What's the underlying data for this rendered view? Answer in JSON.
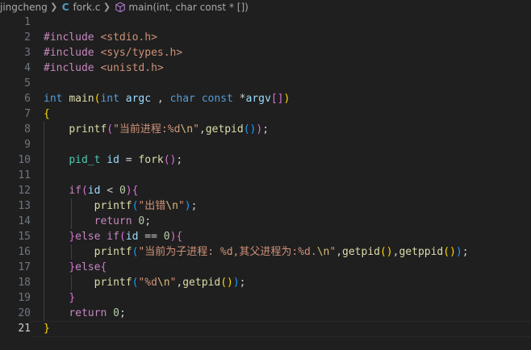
{
  "breadcrumb": {
    "folder": "jingcheng",
    "file": "fork.c",
    "file_icon_letter": "C",
    "symbol": "main(int, char const * [])",
    "symbol_icon": "cube-icon",
    "separator_icon": "chevron-right-icon"
  },
  "editor": {
    "language": "c",
    "active_line": 21,
    "theme_colors": {
      "background": "#1f1f1f",
      "keyword": "#c586c0",
      "type": "#569cd6",
      "string": "#ce9178",
      "function": "#dcdcaa",
      "variable": "#9cdcfe",
      "number": "#b5cea8"
    },
    "lines": [
      {
        "num": "1",
        "tokens": []
      },
      {
        "num": "2",
        "tokens": [
          {
            "t": "#include",
            "c": "t-kw"
          },
          {
            "t": " ",
            "c": "t-pl"
          },
          {
            "t": "<stdio.h>",
            "c": "t-str"
          }
        ]
      },
      {
        "num": "3",
        "tokens": [
          {
            "t": "#include",
            "c": "t-kw"
          },
          {
            "t": " ",
            "c": "t-pl"
          },
          {
            "t": "<sys/types.h>",
            "c": "t-str"
          }
        ]
      },
      {
        "num": "4",
        "tokens": [
          {
            "t": "#include",
            "c": "t-kw"
          },
          {
            "t": " ",
            "c": "t-pl"
          },
          {
            "t": "<unistd.h>",
            "c": "t-str"
          }
        ]
      },
      {
        "num": "5",
        "tokens": []
      },
      {
        "num": "6",
        "tokens": [
          {
            "t": "int",
            "c": "t-ty"
          },
          {
            "t": " ",
            "c": "t-pl"
          },
          {
            "t": "main",
            "c": "t-fn"
          },
          {
            "t": "(",
            "c": "t-b1"
          },
          {
            "t": "int",
            "c": "t-ty"
          },
          {
            "t": " ",
            "c": "t-pl"
          },
          {
            "t": "argc",
            "c": "t-var"
          },
          {
            "t": " , ",
            "c": "t-pl"
          },
          {
            "t": "char",
            "c": "t-ty"
          },
          {
            "t": " ",
            "c": "t-pl"
          },
          {
            "t": "const",
            "c": "t-ty"
          },
          {
            "t": " *",
            "c": "t-pl"
          },
          {
            "t": "argv",
            "c": "t-var"
          },
          {
            "t": "[]",
            "c": "t-b2"
          },
          {
            "t": ")",
            "c": "t-b1"
          }
        ]
      },
      {
        "num": "7",
        "tokens": [
          {
            "t": "{",
            "c": "t-b1"
          }
        ]
      },
      {
        "num": "8",
        "tokens": [
          {
            "t": "    ",
            "c": "t-pl"
          },
          {
            "t": "printf",
            "c": "t-fn"
          },
          {
            "t": "(",
            "c": "t-b2"
          },
          {
            "t": "\"当前进程:%d",
            "c": "t-str"
          },
          {
            "t": "\\n",
            "c": "t-esc"
          },
          {
            "t": "\"",
            "c": "t-str"
          },
          {
            "t": ",",
            "c": "t-pl"
          },
          {
            "t": "getpid",
            "c": "t-fn"
          },
          {
            "t": "()",
            "c": "t-b3"
          },
          {
            "t": ")",
            "c": "t-b2"
          },
          {
            "t": ";",
            "c": "t-pl"
          }
        ]
      },
      {
        "num": "9",
        "tokens": []
      },
      {
        "num": "10",
        "tokens": [
          {
            "t": "    ",
            "c": "t-pl"
          },
          {
            "t": "pid_t",
            "c": "t-tp"
          },
          {
            "t": " ",
            "c": "t-pl"
          },
          {
            "t": "id",
            "c": "t-var"
          },
          {
            "t": " = ",
            "c": "t-pl"
          },
          {
            "t": "fork",
            "c": "t-fn"
          },
          {
            "t": "()",
            "c": "t-b2"
          },
          {
            "t": ";",
            "c": "t-pl"
          }
        ]
      },
      {
        "num": "11",
        "tokens": []
      },
      {
        "num": "12",
        "tokens": [
          {
            "t": "    ",
            "c": "t-pl"
          },
          {
            "t": "if",
            "c": "t-kw"
          },
          {
            "t": "(",
            "c": "t-b2"
          },
          {
            "t": "id",
            "c": "t-var"
          },
          {
            "t": " < ",
            "c": "t-pl"
          },
          {
            "t": "0",
            "c": "t-num"
          },
          {
            "t": ")",
            "c": "t-b2"
          },
          {
            "t": "{",
            "c": "t-b2"
          }
        ]
      },
      {
        "num": "13",
        "tokens": [
          {
            "t": "        ",
            "c": "t-pl"
          },
          {
            "t": "printf",
            "c": "t-fn"
          },
          {
            "t": "(",
            "c": "t-b3"
          },
          {
            "t": "\"出错",
            "c": "t-str"
          },
          {
            "t": "\\n",
            "c": "t-esc"
          },
          {
            "t": "\"",
            "c": "t-str"
          },
          {
            "t": ")",
            "c": "t-b3"
          },
          {
            "t": ";",
            "c": "t-pl"
          }
        ]
      },
      {
        "num": "14",
        "tokens": [
          {
            "t": "        ",
            "c": "t-pl"
          },
          {
            "t": "return",
            "c": "t-kw"
          },
          {
            "t": " ",
            "c": "t-pl"
          },
          {
            "t": "0",
            "c": "t-num"
          },
          {
            "t": ";",
            "c": "t-pl"
          }
        ]
      },
      {
        "num": "15",
        "tokens": [
          {
            "t": "    ",
            "c": "t-pl"
          },
          {
            "t": "}",
            "c": "t-b2"
          },
          {
            "t": "else",
            "c": "t-kw"
          },
          {
            "t": " ",
            "c": "t-pl"
          },
          {
            "t": "if",
            "c": "t-kw"
          },
          {
            "t": "(",
            "c": "t-b2"
          },
          {
            "t": "id",
            "c": "t-var"
          },
          {
            "t": " == ",
            "c": "t-pl"
          },
          {
            "t": "0",
            "c": "t-num"
          },
          {
            "t": ")",
            "c": "t-b2"
          },
          {
            "t": "{",
            "c": "t-b2"
          }
        ]
      },
      {
        "num": "16",
        "tokens": [
          {
            "t": "        ",
            "c": "t-pl"
          },
          {
            "t": "printf",
            "c": "t-fn"
          },
          {
            "t": "(",
            "c": "t-b3"
          },
          {
            "t": "\"当前为子进程: %d,其父进程为:%d.",
            "c": "t-str"
          },
          {
            "t": "\\n",
            "c": "t-esc"
          },
          {
            "t": "\"",
            "c": "t-str"
          },
          {
            "t": ",",
            "c": "t-pl"
          },
          {
            "t": "getpid",
            "c": "t-fn"
          },
          {
            "t": "()",
            "c": "t-b1"
          },
          {
            "t": ",",
            "c": "t-pl"
          },
          {
            "t": "getppid",
            "c": "t-fn"
          },
          {
            "t": "()",
            "c": "t-b1"
          },
          {
            "t": ")",
            "c": "t-b3"
          },
          {
            "t": ";",
            "c": "t-pl"
          }
        ]
      },
      {
        "num": "17",
        "tokens": [
          {
            "t": "    ",
            "c": "t-pl"
          },
          {
            "t": "}",
            "c": "t-b2"
          },
          {
            "t": "else",
            "c": "t-kw"
          },
          {
            "t": "{",
            "c": "t-b2"
          }
        ]
      },
      {
        "num": "18",
        "tokens": [
          {
            "t": "        ",
            "c": "t-pl"
          },
          {
            "t": "printf",
            "c": "t-fn"
          },
          {
            "t": "(",
            "c": "t-b3"
          },
          {
            "t": "\"%d",
            "c": "t-str"
          },
          {
            "t": "\\n",
            "c": "t-esc"
          },
          {
            "t": "\"",
            "c": "t-str"
          },
          {
            "t": ",",
            "c": "t-pl"
          },
          {
            "t": "getpid",
            "c": "t-fn"
          },
          {
            "t": "()",
            "c": "t-b1"
          },
          {
            "t": ")",
            "c": "t-b3"
          },
          {
            "t": ";",
            "c": "t-pl"
          }
        ]
      },
      {
        "num": "19",
        "tokens": [
          {
            "t": "    ",
            "c": "t-pl"
          },
          {
            "t": "}",
            "c": "t-b2"
          }
        ]
      },
      {
        "num": "20",
        "tokens": [
          {
            "t": "    ",
            "c": "t-pl"
          },
          {
            "t": "return",
            "c": "t-kw"
          },
          {
            "t": " ",
            "c": "t-pl"
          },
          {
            "t": "0",
            "c": "t-num"
          },
          {
            "t": ";",
            "c": "t-pl"
          }
        ]
      },
      {
        "num": "21",
        "tokens": [
          {
            "t": "}",
            "c": "t-b1"
          }
        ]
      }
    ]
  }
}
